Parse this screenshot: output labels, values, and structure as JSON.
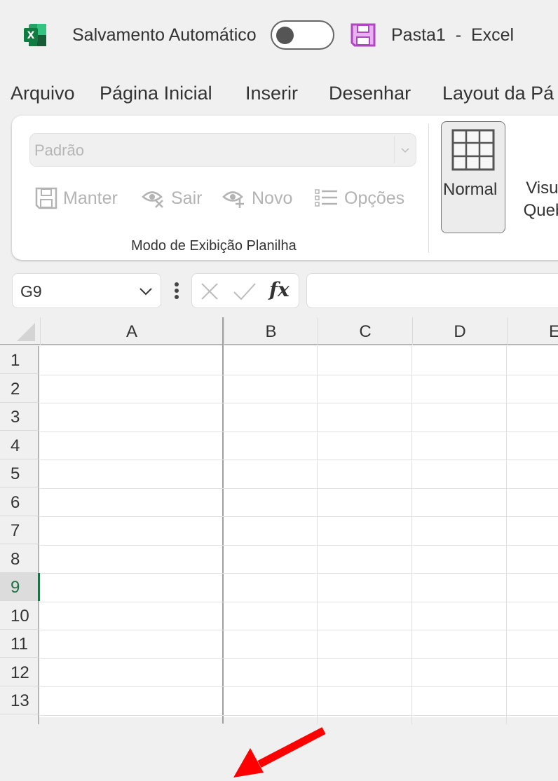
{
  "titlebar": {
    "app_icon": "excel-logo-icon",
    "autosave_label": "Salvamento Automático",
    "autosave_on": false,
    "save_icon": "save-icon",
    "document_title": "Pasta1  -  Excel",
    "colors": {
      "excel_green": "#1e7145",
      "save_purple": "#b146c2"
    }
  },
  "menu": {
    "tabs": [
      {
        "label": "Arquivo"
      },
      {
        "label": "Página Inicial"
      },
      {
        "label": "Inserir"
      },
      {
        "label": "Desenhar"
      },
      {
        "label": "Layout da Pá"
      }
    ]
  },
  "ribbon": {
    "sheet_view_select": {
      "value": "Padrão",
      "disabled": true
    },
    "buttons": [
      {
        "label": "Manter",
        "icon": "save-icon",
        "disabled": true
      },
      {
        "label": "Sair",
        "icon": "eye-close-icon",
        "disabled": true
      },
      {
        "label": "Novo",
        "icon": "eye-add-icon",
        "disabled": true
      },
      {
        "label": "Opções",
        "icon": "list-options-icon",
        "disabled": true
      }
    ],
    "group_label": "Modo de Exibição Planilha",
    "normal_view": {
      "label": "Normal",
      "icon": "grid-icon",
      "selected": true
    },
    "page_break_view": {
      "label": "Visua\nQuebr"
    }
  },
  "formula_bar": {
    "name_box": "G9",
    "cancel_icon": "x-icon",
    "enter_icon": "check-icon",
    "fx_label": "fx",
    "formula_value": ""
  },
  "sheet": {
    "columns": [
      "A",
      "B",
      "C",
      "D",
      "E"
    ],
    "rows": [
      "1",
      "2",
      "3",
      "4",
      "5",
      "6",
      "7",
      "8",
      "9",
      "10",
      "11",
      "12",
      "13"
    ],
    "selected_row": "9",
    "annotation": {
      "type": "arrow",
      "color": "#ff0000",
      "points_to": "column A/B boundary"
    }
  }
}
